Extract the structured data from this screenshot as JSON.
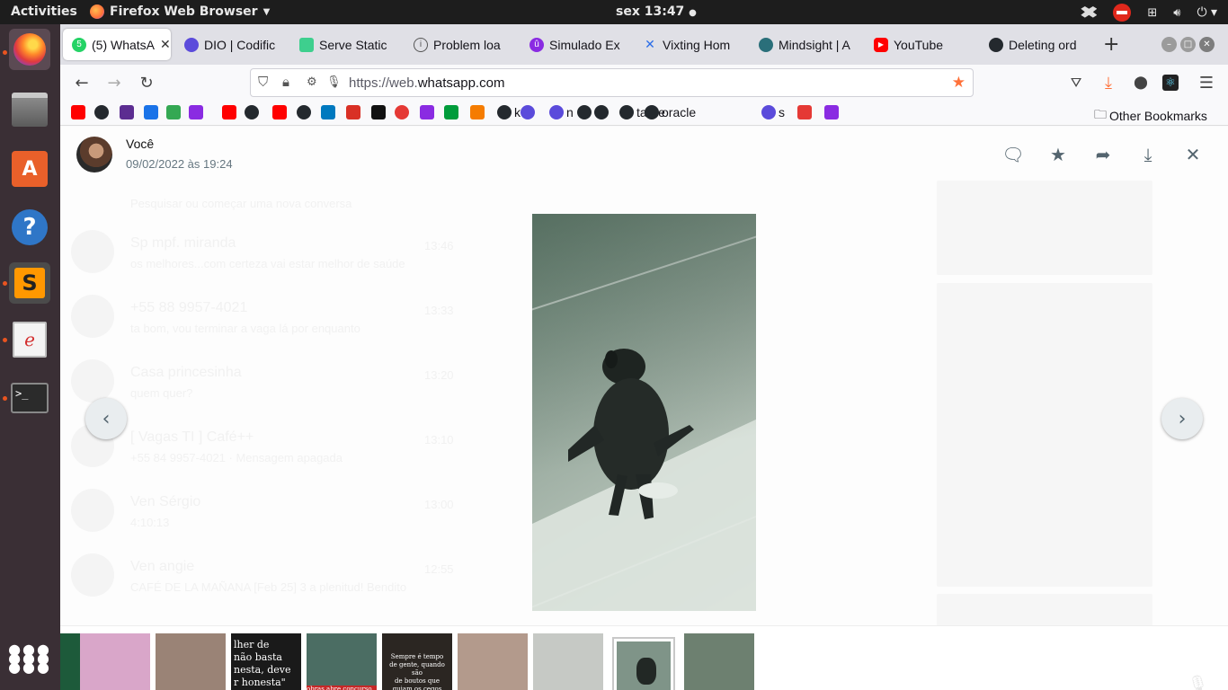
{
  "topbar": {
    "activities": "Activities",
    "app_name": "Firefox Web Browser",
    "clock": "sex 13:47"
  },
  "tabs": [
    {
      "label": "(5) WhatsA",
      "favicon": "whatsapp-icon",
      "color": "#25d366",
      "badge": "5",
      "active": true
    },
    {
      "label": "DIO | Codific",
      "favicon": "dio-icon",
      "color": "#5b4bdb"
    },
    {
      "label": "Serve Static",
      "favicon": "serve-static-icon",
      "color": "#3ecf8e"
    },
    {
      "label": "Problem loa",
      "favicon": "info-icon",
      "color": "#555555"
    },
    {
      "label": "Simulado Ex",
      "favicon": "simulado-icon",
      "color": "#8a2be2"
    },
    {
      "label": "Vixting Hom",
      "favicon": "vixting-icon",
      "color": "#2b6de8"
    },
    {
      "label": "Mindsight | A",
      "favicon": "mindsight-icon",
      "color": "#2a6f7a"
    },
    {
      "label": "YouTube",
      "favicon": "youtube-icon",
      "color": "#ff0000"
    },
    {
      "label": "Deleting ord",
      "favicon": "github-icon",
      "color": "#24292e"
    }
  ],
  "url": {
    "prefix": "https://web.",
    "domain": "whatsapp.com"
  },
  "bookmarks": {
    "items": [
      {
        "label": "",
        "icon": "youtube-icon",
        "color": "#ff0000"
      },
      {
        "label": "",
        "icon": "github-icon",
        "color": "#24292e"
      },
      {
        "label": "",
        "icon": "deezer-icon",
        "color": "#5c2d91"
      },
      {
        "label": "",
        "icon": "play-icon",
        "color": "#1a73e8"
      },
      {
        "label": "",
        "icon": "leaf-icon",
        "color": "#34a853"
      },
      {
        "label": "",
        "icon": "simulado-icon",
        "color": "#8a2be2"
      },
      {
        "label": "",
        "icon": "youtube-icon",
        "color": "#ff0000"
      },
      {
        "label": "",
        "icon": "github-icon",
        "color": "#24292e"
      },
      {
        "label": "",
        "icon": "youtube-icon",
        "color": "#ff0000"
      },
      {
        "label": "",
        "icon": "github-icon",
        "color": "#24292e"
      },
      {
        "label": "",
        "icon": "trello-icon",
        "color": "#0079bf"
      },
      {
        "label": "",
        "icon": "gmail-icon",
        "color": "#d93025"
      },
      {
        "label": "",
        "icon": "codepen-icon",
        "color": "#111111"
      },
      {
        "label": "",
        "icon": "circle-icon",
        "color": "#e53935"
      },
      {
        "label": "",
        "icon": "simulado-icon",
        "color": "#8a2be2"
      },
      {
        "label": "",
        "icon": "brazil-icon",
        "color": "#009c3b"
      },
      {
        "label": "",
        "icon": "box-icon",
        "color": "#f57c00"
      },
      {
        "label": "k",
        "icon": "github-icon",
        "color": "#24292e"
      },
      {
        "label": "",
        "icon": "dio-icon",
        "color": "#5b4bdb"
      },
      {
        "label": "n",
        "icon": "dio-icon",
        "color": "#5b4bdb"
      },
      {
        "label": "",
        "icon": "github-icon",
        "color": "#24292e"
      },
      {
        "label": "",
        "icon": "github-icon",
        "color": "#24292e"
      },
      {
        "label": "tarde",
        "icon": "github-icon",
        "color": "#24292e"
      },
      {
        "label": "oracle",
        "icon": "github-icon",
        "color": "#24292e"
      },
      {
        "label": "s",
        "icon": "dio-icon",
        "color": "#5b4bdb"
      },
      {
        "label": "",
        "icon": "oracle-icon",
        "color": "#e53935"
      },
      {
        "label": "",
        "icon": "simulado-icon",
        "color": "#8a2be2"
      }
    ],
    "other": "Other Bookmarks"
  },
  "viewer": {
    "sender": "Você",
    "timestamp": "09/02/2022 às 19:24",
    "ghost_search": "Pesquisar ou começar uma nova conversa",
    "ghost_chats": [
      {
        "name": "Sp mpf. miranda",
        "preview": "os melhores...com certeza vai estar melhor de saúde",
        "time": "13:46"
      },
      {
        "name": "+55 88 9957-4021",
        "preview": "ta bom, vou terminar a vaga lá por enquanto",
        "time": "13:33"
      },
      {
        "name": "Casa princesinha",
        "preview": "quem quer?",
        "time": "13:20"
      },
      {
        "name": "[ Vagas TI ] Café++",
        "preview": "+55 84 9957-4021 · Mensagem apagada",
        "time": "13:10"
      },
      {
        "name": "Ven Sérgio",
        "preview": "4:10:13",
        "time": "13:00"
      },
      {
        "name": "Ven angie",
        "preview": "CAFÉ DE LA MAÑANA [Feb 25] 3 a plenitud! Bendito",
        "time": "12:55"
      }
    ]
  },
  "thumbs": [
    {
      "name": "thumb-green-flyer",
      "text": "",
      "color": "#1d5a3a"
    },
    {
      "name": "thumb-bunny",
      "text": "",
      "color": "#d9a6c9"
    },
    {
      "name": "thumb-puppy-basket",
      "text": "",
      "color": "#9a8376"
    },
    {
      "name": "thumb-quote-1",
      "text": "lher de\nnão basta\nnesta, deve\nr honesta\"",
      "color": "#1a1a1a"
    },
    {
      "name": "thumb-concurso",
      "text": "obras abre concurso com 7\nas de nível superior",
      "color": "#4b6d63"
    },
    {
      "name": "thumb-quote-2",
      "text": "Sempre é tempo\nde gente, quando são\nde boutos que\nguiam os cegos",
      "color": "#2b2622"
    },
    {
      "name": "thumb-puppies-bed",
      "text": "",
      "color": "#b39a8c"
    },
    {
      "name": "thumb-white-puppy",
      "text": "",
      "color": "#c6c9c5"
    },
    {
      "name": "thumb-black-puppy",
      "text": "",
      "color": "#7f9488",
      "selected": true
    },
    {
      "name": "thumb-floor-puppy",
      "text": "",
      "color": "#6d8070"
    }
  ]
}
